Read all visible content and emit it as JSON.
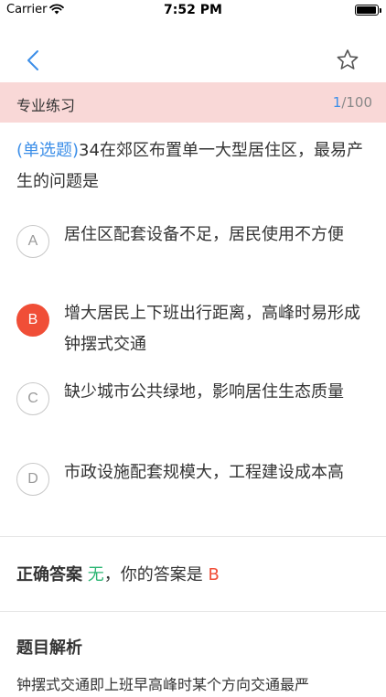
{
  "status_bar": {
    "carrier": "Carrier",
    "time": "7:52 PM",
    "battery_level": 0.95,
    "wifi_icon": "wifi-icon",
    "battery_icon": "battery-icon"
  },
  "nav": {
    "back_icon": "chevron-left-icon",
    "favorite_icon": "star-outline-icon",
    "accent_color": "#3b8ee8"
  },
  "practice": {
    "title": "专业练习",
    "current": "1",
    "total": "/100"
  },
  "question": {
    "type_label": "(单选题)",
    "text": "34在郊区布置单一大型居住区，最易产生的问题是"
  },
  "options": [
    {
      "letter": "A",
      "text": "居住区配套设备不足，居民使用不方便",
      "selected": false
    },
    {
      "letter": "B",
      "text": "增大居民上下班出行距离，高峰时易形成钟摆式交通",
      "selected": true
    },
    {
      "letter": "C",
      "text": "缺少城市公共绿地，影响居住生态质量",
      "selected": false
    },
    {
      "letter": "D",
      "text": "市政设施配套规模大，工程建设成本高",
      "selected": false
    }
  ],
  "answer": {
    "correct_label": "正确答案",
    "correct_value": "无",
    "yours_label": "，你的答案是",
    "yours_value": "B"
  },
  "analysis": {
    "title": "题目解析",
    "body": "钟摆式交通即上班早高峰时某个方向交通最严"
  },
  "colors": {
    "header_band": "#f9d8d7",
    "selected": "#f04e37",
    "correct": "#2bb673"
  }
}
